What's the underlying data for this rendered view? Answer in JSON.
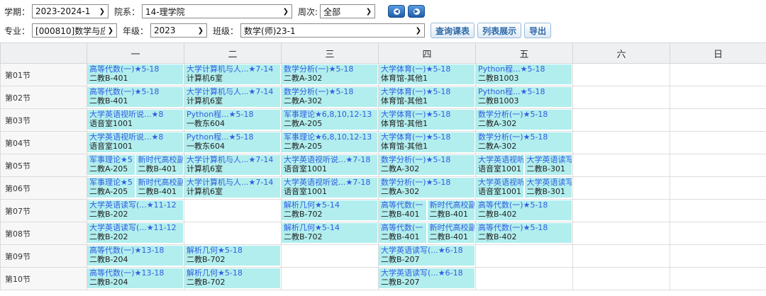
{
  "filters": {
    "term_label": "学期：",
    "term_value": "2023-2024-1",
    "dept_label": "院系：",
    "dept_value": "14-理学院",
    "week_label": "周次:",
    "week_value": "全部",
    "major_label": "专业：",
    "major_value": "[000810]数学与应",
    "grade_label": "年级：",
    "grade_value": "2023",
    "class_label": "班级：",
    "class_value": "数学(师)23-1",
    "btn_query": "查询课表",
    "btn_list": "列表展示",
    "btn_export": "导出"
  },
  "days": [
    "一",
    "二",
    "三",
    "四",
    "五",
    "六",
    "日"
  ],
  "periods": [
    {
      "label": "第01节",
      "cells": [
        [
          {
            "t": "高等代数(一)★5-18",
            "r": "二教B-401"
          }
        ],
        [
          {
            "t": "大学计算机与人...★7-14",
            "r": "计算机6室"
          }
        ],
        [
          {
            "t": "数学分析(一)★5-18",
            "r": "二教A-302"
          }
        ],
        [
          {
            "t": "大学体育(一)★5-18",
            "r": "体育馆-其他1"
          }
        ],
        [
          {
            "t": "Python程...★5-18",
            "r": "二教B1003"
          }
        ],
        [],
        []
      ]
    },
    {
      "label": "第02节",
      "cells": [
        [
          {
            "t": "高等代数(一)★5-18",
            "r": "二教B-401"
          }
        ],
        [
          {
            "t": "大学计算机与人...★7-14",
            "r": "计算机6室"
          }
        ],
        [
          {
            "t": "数学分析(一)★5-18",
            "r": "二教A-302"
          }
        ],
        [
          {
            "t": "大学体育(一)★5-18",
            "r": "体育馆-其他1"
          }
        ],
        [
          {
            "t": "Python程...★5-18",
            "r": "二教B1003"
          }
        ],
        [],
        []
      ]
    },
    {
      "label": "第03节",
      "cells": [
        [
          {
            "t": "大学英语视听说...★8",
            "r": "语音室1001"
          }
        ],
        [
          {
            "t": "Python程...★5-18",
            "r": "一教东604"
          }
        ],
        [
          {
            "t": "军事理论★6,8,10,12-13",
            "r": "二教A-205"
          }
        ],
        [
          {
            "t": "大学体育(一)★5-18",
            "r": "体育馆-其他1"
          }
        ],
        [
          {
            "t": "数学分析(一)★5-18",
            "r": "二教A-302"
          }
        ],
        [],
        []
      ]
    },
    {
      "label": "第04节",
      "cells": [
        [
          {
            "t": "大学英语视听说...★8",
            "r": "语音室1001"
          }
        ],
        [
          {
            "t": "Python程...★5-18",
            "r": "一教东604"
          }
        ],
        [
          {
            "t": "军事理论★6,8,10,12-13",
            "r": "二教A-205"
          }
        ],
        [
          {
            "t": "大学体育(一)★5-18",
            "r": "体育馆-其他1"
          }
        ],
        [
          {
            "t": "数学分析(一)★5-18",
            "r": "二教A-302"
          }
        ],
        [],
        []
      ]
    },
    {
      "label": "第05节",
      "cells": [
        [
          {
            "t": "军事理论★5",
            "r": "二教A-205"
          },
          {
            "t": "新时代高校副",
            "r": "二教B-401"
          }
        ],
        [
          {
            "t": "大学计算机与人...★7-14",
            "r": "计算机6室"
          }
        ],
        [
          {
            "t": "大学英语视听说...★7-18",
            "r": "语音室1001"
          }
        ],
        [
          {
            "t": "数学分析(一)★5-18",
            "r": "二教A-302"
          }
        ],
        [
          {
            "t": "大学英语视听",
            "r": "语音室1001"
          },
          {
            "t": "大学英语读写",
            "r": "二教B-301"
          }
        ],
        [],
        []
      ]
    },
    {
      "label": "第06节",
      "cells": [
        [
          {
            "t": "军事理论★5",
            "r": "二教A-205"
          },
          {
            "t": "新时代高校副",
            "r": "二教B-401"
          }
        ],
        [
          {
            "t": "大学计算机与人...★7-14",
            "r": "计算机6室"
          }
        ],
        [
          {
            "t": "大学英语视听说...★7-18",
            "r": "语音室1001"
          }
        ],
        [
          {
            "t": "数学分析(一)★5-18",
            "r": "二教A-302"
          }
        ],
        [
          {
            "t": "大学英语视听",
            "r": "语音室1001"
          },
          {
            "t": "大学英语读写",
            "r": "二教B-301"
          }
        ],
        [],
        []
      ]
    },
    {
      "label": "第07节",
      "cells": [
        [
          {
            "t": "大学英语读写(...★11-12",
            "r": "二教B-202"
          }
        ],
        [],
        [
          {
            "t": "解析几何★5-14",
            "r": "二教B-702"
          }
        ],
        [
          {
            "t": "高等代数(一",
            "r": "二教B-401"
          },
          {
            "t": "新时代高校副",
            "r": "二教B-401"
          }
        ],
        [
          {
            "t": "高等代数(一)★5-18",
            "r": "二教B-402"
          }
        ],
        [],
        []
      ]
    },
    {
      "label": "第08节",
      "cells": [
        [
          {
            "t": "大学英语读写(...★11-12",
            "r": "二教B-202"
          }
        ],
        [],
        [
          {
            "t": "解析几何★5-14",
            "r": "二教B-702"
          }
        ],
        [
          {
            "t": "高等代数(一",
            "r": "二教B-401"
          },
          {
            "t": "新时代高校副",
            "r": "二教B-401"
          }
        ],
        [
          {
            "t": "高等代数(一)★5-18",
            "r": "二教B-402"
          }
        ],
        [],
        []
      ]
    },
    {
      "label": "第09节",
      "cells": [
        [
          {
            "t": "高等代数(一)★13-18",
            "r": "二教B-204"
          }
        ],
        [
          {
            "t": "解析几何★5-18",
            "r": "二教B-702"
          }
        ],
        [],
        [
          {
            "t": "大学英语读写(...★6-18",
            "r": "二教B-207"
          }
        ],
        [],
        [],
        []
      ]
    },
    {
      "label": "第10节",
      "cells": [
        [
          {
            "t": "高等代数(一)★13-18",
            "r": "二教B-204"
          }
        ],
        [
          {
            "t": "解析几何★5-18",
            "r": "二教B-702"
          }
        ],
        [],
        [
          {
            "t": "大学英语读写(...★6-18",
            "r": "二教B-207"
          }
        ],
        [],
        [],
        []
      ]
    }
  ]
}
